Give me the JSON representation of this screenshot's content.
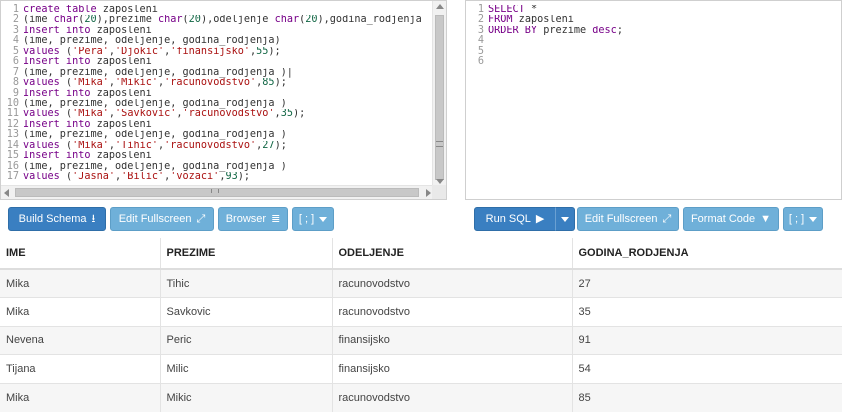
{
  "schema_editor": {
    "lines": [
      {
        "n": "1",
        "parts": [
          {
            "t": "create table",
            "c": "kw"
          },
          {
            "t": " zaposleni",
            "c": "txt"
          }
        ]
      },
      {
        "n": "2",
        "parts": [
          {
            "t": "(ime ",
            "c": "txt"
          },
          {
            "t": "char",
            "c": "kw"
          },
          {
            "t": "(",
            "c": "txt"
          },
          {
            "t": "20",
            "c": "num"
          },
          {
            "t": "),prezime ",
            "c": "txt"
          },
          {
            "t": "char",
            "c": "kw"
          },
          {
            "t": "(",
            "c": "txt"
          },
          {
            "t": "20",
            "c": "num"
          },
          {
            "t": "),odeljenje ",
            "c": "txt"
          },
          {
            "t": "char",
            "c": "kw"
          },
          {
            "t": "(",
            "c": "txt"
          },
          {
            "t": "20",
            "c": "num"
          },
          {
            "t": "),godina_rodjenja ",
            "c": "txt"
          }
        ]
      },
      {
        "n": "3",
        "parts": [
          {
            "t": "Insert into",
            "c": "kw"
          },
          {
            "t": " zaposleni",
            "c": "txt"
          }
        ]
      },
      {
        "n": "4",
        "parts": [
          {
            "t": "(ime, prezime, odeljenje, godina_rodjenja)",
            "c": "txt"
          }
        ]
      },
      {
        "n": "5",
        "parts": [
          {
            "t": "values",
            "c": "kw"
          },
          {
            "t": " (",
            "c": "txt"
          },
          {
            "t": "'Pera'",
            "c": "str"
          },
          {
            "t": ",",
            "c": "txt"
          },
          {
            "t": "'Djokic'",
            "c": "str"
          },
          {
            "t": ",",
            "c": "txt"
          },
          {
            "t": "'finansijsko'",
            "c": "str"
          },
          {
            "t": ",",
            "c": "txt"
          },
          {
            "t": "55",
            "c": "num"
          },
          {
            "t": ");",
            "c": "txt"
          }
        ]
      },
      {
        "n": "6",
        "parts": [
          {
            "t": "Insert into",
            "c": "kw"
          },
          {
            "t": " zaposleni",
            "c": "txt"
          }
        ]
      },
      {
        "n": "7",
        "parts": [
          {
            "t": "(ime, prezime, odeljenje, godina_rodjenja )|",
            "c": "txt"
          }
        ]
      },
      {
        "n": "8",
        "parts": [
          {
            "t": "values",
            "c": "kw"
          },
          {
            "t": " (",
            "c": "txt"
          },
          {
            "t": "'Mika'",
            "c": "str"
          },
          {
            "t": ",",
            "c": "txt"
          },
          {
            "t": "'Mikic'",
            "c": "str"
          },
          {
            "t": ",",
            "c": "txt"
          },
          {
            "t": "'racunovodstvo'",
            "c": "str"
          },
          {
            "t": ",",
            "c": "txt"
          },
          {
            "t": "85",
            "c": "num"
          },
          {
            "t": ");",
            "c": "txt"
          }
        ]
      },
      {
        "n": "9",
        "parts": [
          {
            "t": "Insert into",
            "c": "kw"
          },
          {
            "t": " zaposleni",
            "c": "txt"
          }
        ]
      },
      {
        "n": "10",
        "parts": [
          {
            "t": "(ime, prezime, odeljenje, godina_rodjenja )",
            "c": "txt"
          }
        ]
      },
      {
        "n": "11",
        "parts": [
          {
            "t": "values",
            "c": "kw"
          },
          {
            "t": " (",
            "c": "txt"
          },
          {
            "t": "'Mika'",
            "c": "str"
          },
          {
            "t": ",",
            "c": "txt"
          },
          {
            "t": "'Savkovic'",
            "c": "str"
          },
          {
            "t": ",",
            "c": "txt"
          },
          {
            "t": "'racunovodstvo'",
            "c": "str"
          },
          {
            "t": ",",
            "c": "txt"
          },
          {
            "t": "35",
            "c": "num"
          },
          {
            "t": ");",
            "c": "txt"
          }
        ]
      },
      {
        "n": "12",
        "parts": [
          {
            "t": "Insert into",
            "c": "kw"
          },
          {
            "t": " zaposleni",
            "c": "txt"
          }
        ]
      },
      {
        "n": "13",
        "parts": [
          {
            "t": "(ime, prezime, odeljenje, godina_rodjenja )",
            "c": "txt"
          }
        ]
      },
      {
        "n": "14",
        "parts": [
          {
            "t": "values",
            "c": "kw"
          },
          {
            "t": " (",
            "c": "txt"
          },
          {
            "t": "'Mika'",
            "c": "str"
          },
          {
            "t": ",",
            "c": "txt"
          },
          {
            "t": "'Tihic'",
            "c": "str"
          },
          {
            "t": ",",
            "c": "txt"
          },
          {
            "t": "'racunovodstvo'",
            "c": "str"
          },
          {
            "t": ",",
            "c": "txt"
          },
          {
            "t": "27",
            "c": "num"
          },
          {
            "t": ");",
            "c": "txt"
          }
        ]
      },
      {
        "n": "15",
        "parts": [
          {
            "t": "Insert into",
            "c": "kw"
          },
          {
            "t": " zaposleni",
            "c": "txt"
          }
        ]
      },
      {
        "n": "16",
        "parts": [
          {
            "t": "(ime, prezime, odeljenje, godina_rodjenja )",
            "c": "txt"
          }
        ]
      },
      {
        "n": "17",
        "parts": [
          {
            "t": "values",
            "c": "kw"
          },
          {
            "t": " (",
            "c": "txt"
          },
          {
            "t": "'Jasna'",
            "c": "str"
          },
          {
            "t": ",",
            "c": "txt"
          },
          {
            "t": "'Bilic'",
            "c": "str"
          },
          {
            "t": ",",
            "c": "txt"
          },
          {
            "t": "'vozaci'",
            "c": "str"
          },
          {
            "t": ",",
            "c": "txt"
          },
          {
            "t": "93",
            "c": "num"
          },
          {
            "t": ");",
            "c": "txt"
          }
        ]
      }
    ]
  },
  "query_editor": {
    "lines": [
      {
        "n": "1",
        "parts": [
          {
            "t": "SELECT",
            "c": "kw"
          },
          {
            "t": " *",
            "c": "txt"
          }
        ]
      },
      {
        "n": "2",
        "parts": [
          {
            "t": "FROM",
            "c": "kw"
          },
          {
            "t": " zaposleni",
            "c": "txt"
          }
        ]
      },
      {
        "n": "3",
        "parts": [
          {
            "t": "ORDER BY",
            "c": "kw"
          },
          {
            "t": " prezime ",
            "c": "txt"
          },
          {
            "t": "desc",
            "c": "kw"
          },
          {
            "t": ";",
            "c": "txt"
          }
        ]
      },
      {
        "n": "4",
        "parts": []
      },
      {
        "n": "5",
        "parts": []
      },
      {
        "n": "6",
        "parts": []
      }
    ]
  },
  "toolbar_left": {
    "build_schema": "Build Schema",
    "edit_fullscreen": "Edit Fullscreen",
    "browser": "Browser",
    "more": "[ ; ]"
  },
  "toolbar_right": {
    "run_sql": "Run SQL",
    "edit_fullscreen": "Edit Fullscreen",
    "format_code": "Format Code",
    "more": "[ ; ]"
  },
  "results": {
    "columns": [
      "IME",
      "PREZIME",
      "ODELJENJE",
      "GODINA_RODJENJA"
    ],
    "rows": [
      [
        "Mika",
        "Tihic",
        "racunovodstvo",
        "27"
      ],
      [
        "Mika",
        "Savkovic",
        "racunovodstvo",
        "35"
      ],
      [
        "Nevena",
        "Peric",
        "finansijsko",
        "91"
      ],
      [
        "Tijana",
        "Milic",
        "finansijsko",
        "54"
      ],
      [
        "Mika",
        "Mikic",
        "racunovodstvo",
        "85"
      ]
    ]
  },
  "colors": {
    "button_dark": "#3a7fc1",
    "button_light": "#6fb0d9",
    "keyword": "#770088",
    "string": "#aa1111",
    "number": "#116644"
  }
}
